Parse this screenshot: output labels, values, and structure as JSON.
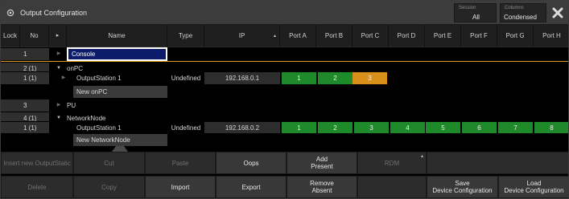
{
  "window": {
    "title": "Output Configuration",
    "session_label": "Session",
    "session_value": "All",
    "columns_label": "Columns",
    "columns_value": "Condensed"
  },
  "headers": {
    "lock": "Lock",
    "no": "No",
    "arrow": "▸",
    "name": "Name",
    "type": "Type",
    "ip": "IP",
    "ip_sort": "▲",
    "ports": [
      "Port A",
      "Port B",
      "Port C",
      "Port D",
      "Port E",
      "Port F",
      "Port G",
      "Port H"
    ]
  },
  "rows": {
    "console": {
      "no": "1",
      "name": "Console"
    },
    "onpc": {
      "no": "2 (1)",
      "name": "onPC"
    },
    "os1": {
      "no": "1 (1)",
      "name": "OutputStation 1",
      "type": "Undefined",
      "ip": "192.168.0.1",
      "ports": [
        "1",
        "2",
        "3"
      ]
    },
    "new_onpc": {
      "name": "New onPC"
    },
    "pu": {
      "no": "3",
      "name": "PU"
    },
    "networknode": {
      "no": "4 (1)",
      "name": "NetworkNode"
    },
    "os1b": {
      "no": "1 (1)",
      "name": "OutputStation 1",
      "type": "Undefined",
      "ip": "192.168.0.2",
      "ports": [
        "1",
        "2",
        "3",
        "4",
        "5",
        "6",
        "7",
        "8"
      ]
    },
    "new_networknode": {
      "name": "New NetworkNode"
    }
  },
  "colors": {
    "port_ok": "#1f8a2a",
    "port_warn": "#d9901a",
    "selection": "#0d1b6b",
    "separator": "#d8a020"
  },
  "buttons": {
    "insert": "Insert new OutputStatic",
    "cut": "Cut",
    "paste": "Paste",
    "oops": "Oops",
    "add_present_1": "Add",
    "add_present_2": "Present",
    "rdm": "RDM",
    "delete": "Delete",
    "copy": "Copy",
    "import": "Import",
    "export": "Export",
    "remove_absent_1": "Remove",
    "remove_absent_2": "Absent",
    "save_1": "Save",
    "save_2": "Device Configuration",
    "load_1": "Load",
    "load_2": "Device Configuration"
  }
}
